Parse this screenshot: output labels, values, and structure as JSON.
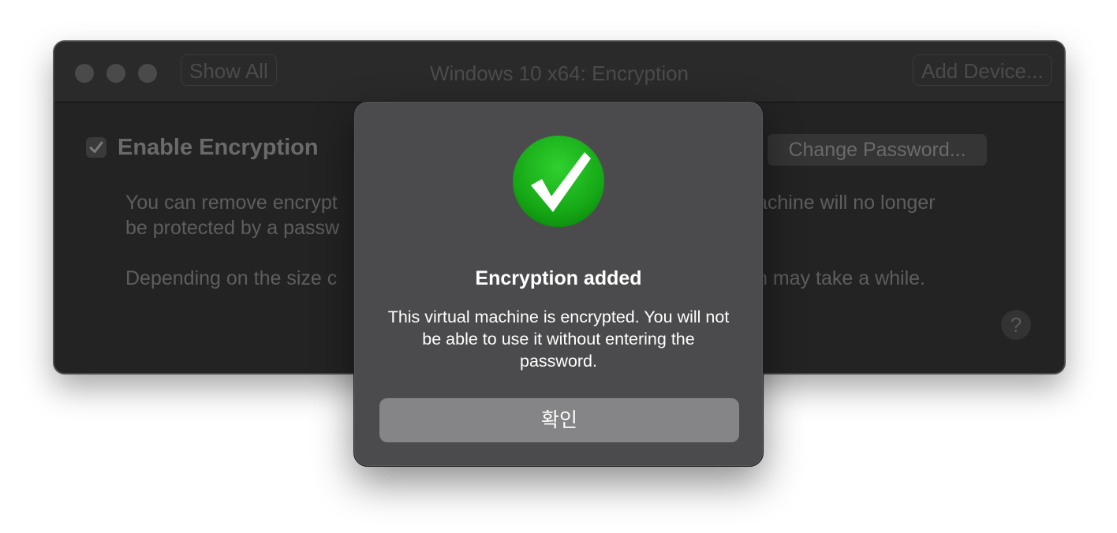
{
  "window": {
    "title": "Windows 10 x64: Encryption",
    "show_all_label": "Show All",
    "add_device_label": "Add Device..."
  },
  "settings": {
    "enable_encryption_label": "Enable Encryption",
    "enable_encryption_checked": true,
    "change_password_label": "Change Password...",
    "paragraph1_line1_left": "You can remove encrypt",
    "paragraph1_line1_right": "achine will no longer",
    "paragraph1_line2_left": "be protected by a passw",
    "paragraph2_left": "Depending on the size c",
    "paragraph2_right": "n may take a while.",
    "help_label": "?"
  },
  "alert": {
    "icon": "green-checkmark-icon",
    "title": "Encryption added",
    "message": "This virtual machine is encrypted. You will not be able to use it without entering the password.",
    "ok_label": "확인"
  },
  "colors": {
    "alert_background": "#4b4b4d",
    "ok_button": "#858587",
    "check_green": "#1aa31a"
  }
}
